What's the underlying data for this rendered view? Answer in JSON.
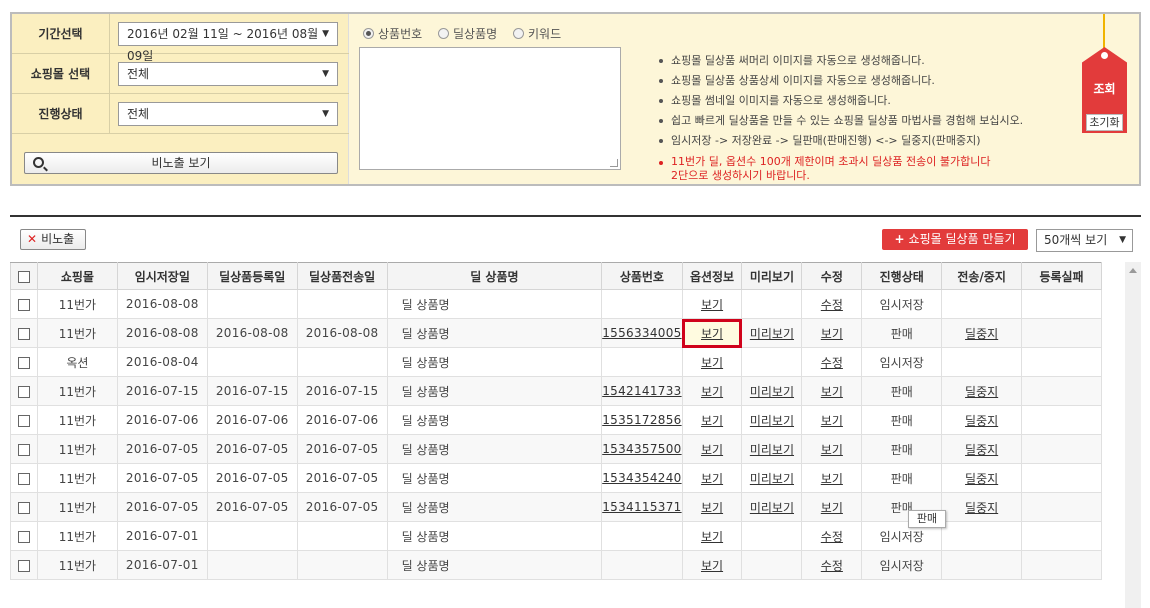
{
  "filters": {
    "period": {
      "label": "기간선택",
      "value": "2016년 02월 11일 ~ 2016년 08월 09일"
    },
    "mall": {
      "label": "쇼핑몰 선택",
      "value": "전체"
    },
    "status": {
      "label": "진행상태",
      "value": "전체"
    },
    "hidden_button": "비노출 보기"
  },
  "search_type": {
    "options": [
      "상품번호",
      "딜상품명",
      "키워드"
    ],
    "selected": "상품번호"
  },
  "notes": [
    "쇼핑몰 딜상품 써머리 이미지를 자동으로 생성해줍니다.",
    "쇼핑몰 딜상품 상품상세 이미지를 자동으로 생성해줍니다.",
    "쇼핑몰 썸네일 이미지를 자동으로 생성해줍니다.",
    "쉽고 빠르게 딜상품을 만들 수 있는 쇼핑몰 딜상품 마법사를 경험해 보십시오.",
    "임시저장 -> 저장완료 -> 딜판매(판매진행) <-> 딜중지(판매중지)"
  ],
  "warning": {
    "line1": "11번가 딜, 옵션수 100개 제한이며 초과시 딜상품 전송이 불가합니다",
    "line2": "2단으로 생성하시기 바랍니다."
  },
  "tag": {
    "search": "조회",
    "reset": "초기화"
  },
  "toolbar": {
    "hide_button": "비노출",
    "make_button": "쇼핑몰 딜상품 만들기",
    "page_size": "50개씩 보기"
  },
  "table": {
    "headers": [
      "쇼핑몰",
      "임시저장일",
      "딜상품등록일",
      "딜상품전송일",
      "딜 상품명",
      "상품번호",
      "옵션정보",
      "미리보기",
      "수정",
      "진행상태",
      "전송/중지",
      "등록실패"
    ],
    "rows": [
      {
        "mall": "11번가",
        "saved": "2016-08-08",
        "registered": "",
        "sent": "",
        "name": "딜 상품명",
        "number": "",
        "option": "보기",
        "preview": "",
        "edit": "수정",
        "status": "임시저장",
        "action": ""
      },
      {
        "mall": "11번가",
        "saved": "2016-08-08",
        "registered": "2016-08-08",
        "sent": "2016-08-08",
        "name": "딜 상품명",
        "number": "1556334005",
        "option": "보기",
        "preview": "미리보기",
        "edit": "보기",
        "status": "판매",
        "action": "딜중지"
      },
      {
        "mall": "옥션",
        "saved": "2016-08-04",
        "registered": "",
        "sent": "",
        "name": "딜 상품명",
        "number": "",
        "option": "보기",
        "preview": "",
        "edit": "수정",
        "status": "임시저장",
        "action": ""
      },
      {
        "mall": "11번가",
        "saved": "2016-07-15",
        "registered": "2016-07-15",
        "sent": "2016-07-15",
        "name": "딜 상품명",
        "number": "1542141733",
        "option": "보기",
        "preview": "미리보기",
        "edit": "보기",
        "status": "판매",
        "action": "딜중지"
      },
      {
        "mall": "11번가",
        "saved": "2016-07-06",
        "registered": "2016-07-06",
        "sent": "2016-07-06",
        "name": "딜 상품명",
        "number": "1535172856",
        "option": "보기",
        "preview": "미리보기",
        "edit": "보기",
        "status": "판매",
        "action": "딜중지"
      },
      {
        "mall": "11번가",
        "saved": "2016-07-05",
        "registered": "2016-07-05",
        "sent": "2016-07-05",
        "name": "딜 상품명",
        "number": "1534357500",
        "option": "보기",
        "preview": "미리보기",
        "edit": "보기",
        "status": "판매",
        "action": "딜중지"
      },
      {
        "mall": "11번가",
        "saved": "2016-07-05",
        "registered": "2016-07-05",
        "sent": "2016-07-05",
        "name": "딜 상품명",
        "number": "1534354240",
        "option": "보기",
        "preview": "미리보기",
        "edit": "보기",
        "status": "판매",
        "action": "딜중지"
      },
      {
        "mall": "11번가",
        "saved": "2016-07-05",
        "registered": "2016-07-05",
        "sent": "2016-07-05",
        "name": "딜 상품명",
        "number": "1534115371",
        "option": "보기",
        "preview": "미리보기",
        "edit": "보기",
        "status": "판매",
        "action": "딜중지"
      },
      {
        "mall": "11번가",
        "saved": "2016-07-01",
        "registered": "",
        "sent": "",
        "name": "딜 상품명",
        "number": "",
        "option": "보기",
        "preview": "",
        "edit": "수정",
        "status": "임시저장",
        "action": ""
      },
      {
        "mall": "11번가",
        "saved": "2016-07-01",
        "registered": "",
        "sent": "",
        "name": "딜 상품명",
        "number": "",
        "option": "보기",
        "preview": "",
        "edit": "수정",
        "status": "임시저장",
        "action": ""
      }
    ]
  },
  "tooltip": "판매",
  "colors": {
    "accent_red": "#e23b3b",
    "panel_bg": "#fdf6d8",
    "highlight": "#d0021b"
  }
}
